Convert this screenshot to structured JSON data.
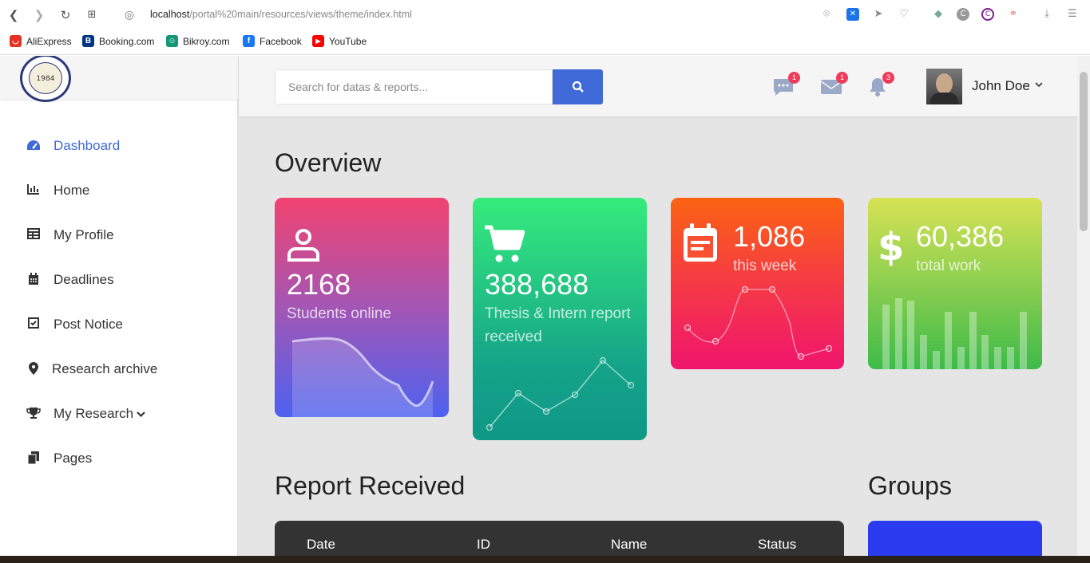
{
  "browser": {
    "url_host": "localhost",
    "url_path": "/portal%20main/resources/views/theme/index.html",
    "bookmarks": [
      {
        "label": "AliExpress",
        "color": "#e43225",
        "glyph": "◡"
      },
      {
        "label": "Booking.com",
        "color": "#003580",
        "glyph": "B"
      },
      {
        "label": "Bikroy.com",
        "color": "#149777",
        "glyph": "☺"
      },
      {
        "label": "Facebook",
        "color": "#1877f2",
        "glyph": "f"
      },
      {
        "label": "YouTube",
        "color": "#ff0000",
        "glyph": "▶"
      }
    ]
  },
  "logo": {
    "text": "1984"
  },
  "sidebar": {
    "items": [
      {
        "label": "Dashboard",
        "icon": "tachometer-icon",
        "active": true
      },
      {
        "label": "Home",
        "icon": "bar-chart-icon"
      },
      {
        "label": "My Profile",
        "icon": "table-icon"
      },
      {
        "label": "Deadlines",
        "icon": "calendar-icon"
      },
      {
        "label": "Post Notice",
        "icon": "check-square-icon"
      },
      {
        "label": "Research archive",
        "icon": "map-marker-icon"
      },
      {
        "label": "My Research",
        "icon": "trophy-icon",
        "caret": "⌄"
      },
      {
        "label": "Pages",
        "icon": "files-icon"
      }
    ]
  },
  "topbar": {
    "search_placeholder": "Search for datas & reports...",
    "messages_count": "1",
    "mail_count": "1",
    "notifications_count": "3",
    "user_name": "John Doe"
  },
  "overview": {
    "title": "Overview",
    "cards": [
      {
        "value": "2168",
        "label": "Students online",
        "gradient": [
          "#f2436f",
          "#4d62f0"
        ]
      },
      {
        "value": "388,688",
        "label": "Thesis & Intern report received",
        "gradient": [
          "#36ec7c",
          "#0f9886"
        ]
      },
      {
        "value": "1,086",
        "label": "this week",
        "gradient": [
          "#fb6312",
          "#f0156d"
        ]
      },
      {
        "value": "60,386",
        "label": "total work",
        "gradient": [
          "#d6e254",
          "#3dbb48"
        ]
      }
    ]
  },
  "reports": {
    "title": "Report Received",
    "columns": [
      "Date",
      "ID",
      "Name",
      "Status"
    ]
  },
  "groups": {
    "title": "Groups"
  }
}
